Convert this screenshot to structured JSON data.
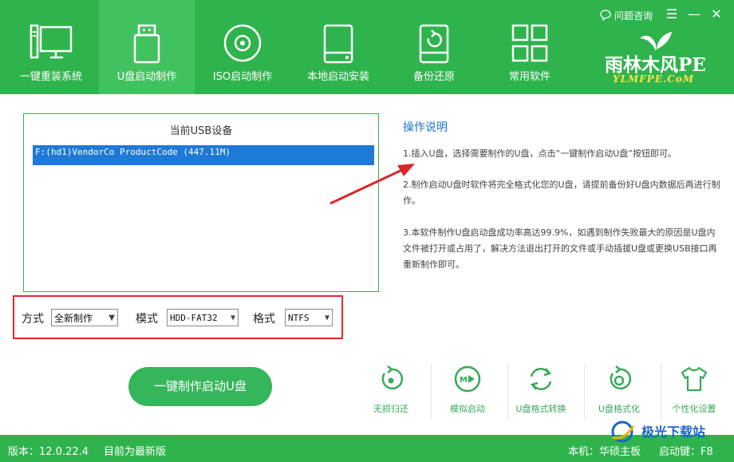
{
  "tabs": [
    {
      "label": "一键重装系统",
      "icon": "monitor-icon"
    },
    {
      "label": "U盘启动制作",
      "icon": "usb-drive-icon",
      "active": true
    },
    {
      "label": "ISO启动制作",
      "icon": "disc-icon"
    },
    {
      "label": "本地启动安装",
      "icon": "hard-drive-icon"
    },
    {
      "label": "备份还原",
      "icon": "backup-drive-icon"
    },
    {
      "label": "常用软件",
      "icon": "grid-icon"
    }
  ],
  "header": {
    "help_label": "问题咨询",
    "logo_line1": "雨林木风PE",
    "logo_line2": "YLMFPE.CoM"
  },
  "usb": {
    "title": "当前USB设备",
    "device": "F:(hd1)VendorCo ProductCode (447.11M)"
  },
  "options": {
    "mode_label": "方式",
    "mode_value": "全新制作",
    "pattern_label": "模式",
    "pattern_value": "HDD-FAT32",
    "format_label": "格式",
    "format_value": "NTFS"
  },
  "make_button": "一键制作启动U盘",
  "instructions": {
    "title": "操作说明",
    "step1": "1.插入U盘，选择需要制作的U盘，点击“一键制作启动U盘”按钮即可。",
    "step2": "2.制作启动U盘时软件将完全格式化您的U盘，请提前备份好U盘内数据后再进行制作。",
    "step3": "3.本软件制作U盘启动盘成功率高达99.9%，如遇到制作失败最大的原因是U盘内文件被打开或占用了，解决方法退出打开的文件或手动插拔U盘或更换USB接口再重新制作即可。"
  },
  "tools": [
    {
      "label": "无损归还",
      "icon": "restore-icon"
    },
    {
      "label": "模拟启动",
      "icon": "simulate-boot-icon"
    },
    {
      "label": "U盘格式转换",
      "icon": "convert-icon"
    },
    {
      "label": "U盘格式化",
      "icon": "format-icon"
    },
    {
      "label": "个性化设置",
      "icon": "tshirt-icon"
    }
  ],
  "status": {
    "version": "版本：12.0.22.4",
    "update": "目前为最新版",
    "board": "本机：华硕主板",
    "hotkey": "启动键：F8"
  },
  "watermark": "极光下载站",
  "colors": {
    "brand_green": "#2fb44d",
    "active_tab": "#42c25f",
    "highlight_red": "#e8262a",
    "link_blue": "#1d76c9"
  }
}
